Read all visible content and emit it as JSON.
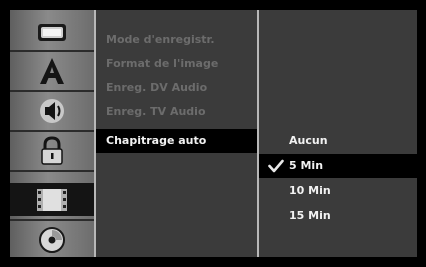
{
  "sidebar": {
    "icons": [
      {
        "name": "disc-tray-icon",
        "selected": false
      },
      {
        "name": "language-a-icon",
        "selected": false
      },
      {
        "name": "speaker-audio-icon",
        "selected": false
      },
      {
        "name": "padlock-icon",
        "selected": false
      },
      {
        "name": "film-record-icon",
        "selected": true
      },
      {
        "name": "disc-icon",
        "selected": false
      }
    ]
  },
  "submenu": {
    "items": [
      {
        "label": "Mode d'enregistr.",
        "enabled": false
      },
      {
        "label": "Format de l'image",
        "enabled": false
      },
      {
        "label": "Enreg. DV Audio",
        "enabled": false
      },
      {
        "label": "Enreg. TV Audio",
        "enabled": false
      },
      {
        "label": "Chapitrage auto",
        "enabled": true,
        "selected": true
      }
    ]
  },
  "options": {
    "items": [
      {
        "label": "Aucun",
        "checked": false
      },
      {
        "label": "5 Min",
        "checked": true
      },
      {
        "label": "10 Min",
        "checked": false
      },
      {
        "label": "15 Min",
        "checked": false
      }
    ]
  },
  "colors": {
    "panel": "#3b3b3b",
    "selection": "#000000",
    "text": "#f2f2f2",
    "disabled_text": "#6c6c6c",
    "icon_column": "#7a7a7a"
  }
}
